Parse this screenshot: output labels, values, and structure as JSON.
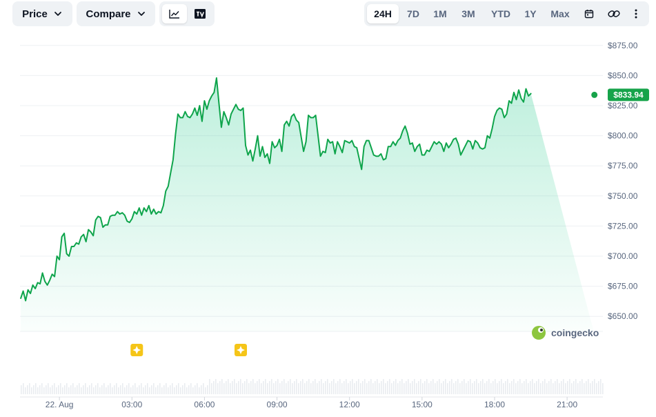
{
  "toolbar": {
    "price_label": "Price",
    "compare_label": "Compare",
    "ranges": [
      "24H",
      "7D",
      "1M",
      "3M",
      "YTD",
      "1Y",
      "Max"
    ],
    "active_range": "24H",
    "icons": {
      "line_chart": "line-chart-icon",
      "tradingview": "tradingview-icon",
      "calendar": "calendar-icon",
      "link": "link-icon",
      "more": "more-vertical-icon"
    }
  },
  "watermark": {
    "text": "coingecko"
  },
  "colors": {
    "line": "#16c784",
    "line_dark": "#0ea44b",
    "badge": "#16a34a",
    "event_marker": "#f5c518"
  },
  "chart_data": {
    "type": "area",
    "title": "",
    "xlabel": "",
    "ylabel": "",
    "ylim": [
      637.5,
      887.5
    ],
    "y_ticks": [
      "$875.00",
      "$850.00",
      "$825.00",
      "$800.00",
      "$775.00",
      "$750.00",
      "$725.00",
      "$700.00",
      "$675.00",
      "$650.00"
    ],
    "y_tick_values": [
      875,
      850,
      825,
      800,
      775,
      750,
      725,
      700,
      675,
      650
    ],
    "x_ticks": [
      "22. Aug",
      "03:00",
      "06:00",
      "09:00",
      "12:00",
      "15:00",
      "18:00",
      "21:00"
    ],
    "x_tick_hours": [
      0,
      3,
      6,
      9,
      12,
      15,
      18,
      21
    ],
    "xlim_hours": [
      -1.63,
      22.48
    ],
    "current_price_label": "$833.94",
    "current_price": 833.94,
    "event_markers_hours": [
      3.2,
      7.5
    ],
    "series": [
      {
        "x_hours": [
          -1.6,
          -1.5,
          -1.4,
          -1.3,
          -1.2,
          -1.1,
          -1.0,
          -0.9,
          -0.8,
          -0.7,
          -0.6,
          -0.5,
          -0.4,
          -0.3,
          -0.2,
          -0.1,
          0.0,
          0.1,
          0.2,
          0.3,
          0.4,
          0.5,
          0.6,
          0.7,
          0.8,
          0.9,
          1.0,
          1.1,
          1.2,
          1.3,
          1.4,
          1.5,
          1.6,
          1.7,
          1.8,
          1.9,
          2.0,
          2.1,
          2.2,
          2.3,
          2.4,
          2.5,
          2.6,
          2.7,
          2.8,
          2.9,
          3.0,
          3.1,
          3.2,
          3.3,
          3.4,
          3.5,
          3.6,
          3.7,
          3.8,
          3.9,
          4.0,
          4.1,
          4.2,
          4.3,
          4.4,
          4.5,
          4.6,
          4.7,
          4.8,
          4.9,
          5.0,
          5.1,
          5.2,
          5.3,
          5.4,
          5.5,
          5.6,
          5.7,
          5.8,
          5.9,
          6.0,
          6.1,
          6.2,
          6.3,
          6.4,
          6.5,
          6.6,
          6.7,
          6.8,
          6.9,
          7.0,
          7.1,
          7.2,
          7.3,
          7.4,
          7.5,
          7.6,
          7.7,
          7.8,
          7.9,
          8.0,
          8.1,
          8.2,
          8.3,
          8.4,
          8.5,
          8.6,
          8.7,
          8.8,
          8.9,
          9.0,
          9.1,
          9.2,
          9.3,
          9.4,
          9.5,
          9.6,
          9.7,
          9.8,
          9.9,
          10.0,
          10.1,
          10.2,
          10.3,
          10.4,
          10.5,
          10.6,
          10.7,
          10.8,
          10.9,
          11.0,
          11.1,
          11.2,
          11.3,
          11.4,
          11.5,
          11.6,
          11.7,
          11.8,
          11.9,
          12.0,
          12.1,
          12.2,
          12.3,
          12.4,
          12.5,
          12.6,
          12.7,
          12.8,
          12.9,
          13.0,
          13.1,
          13.2,
          13.3,
          13.4,
          13.5,
          13.6,
          13.7,
          13.8,
          13.9,
          14.0,
          14.1,
          14.2,
          14.3,
          14.4,
          14.5,
          14.6,
          14.7,
          14.8,
          14.9,
          15.0,
          15.1,
          15.2,
          15.3,
          15.4,
          15.5,
          15.6,
          15.7,
          15.8,
          15.9,
          16.0,
          16.1,
          16.2,
          16.3,
          16.4,
          16.5,
          16.6,
          16.7,
          16.8,
          16.9,
          17.0,
          17.1,
          17.2,
          17.3,
          17.4,
          17.5,
          17.6,
          17.7,
          17.8,
          17.9,
          18.0,
          18.1,
          18.2,
          18.3,
          18.4,
          18.5,
          18.6,
          18.7,
          18.8,
          18.9,
          19.0,
          19.1,
          19.2,
          19.3,
          19.4,
          19.5,
          19.6,
          19.7,
          19.8,
          19.9,
          20.0,
          20.1,
          20.2,
          20.3,
          20.4,
          20.5,
          20.6,
          20.7,
          20.8,
          20.9,
          21.0,
          21.1,
          21.2,
          21.3,
          21.4,
          21.5,
          21.6,
          21.7,
          21.8,
          21.9,
          22.0,
          22.1
        ],
        "values": [
          665,
          671,
          663,
          672,
          669,
          676,
          673,
          678,
          677,
          686,
          679,
          676,
          680,
          685,
          683,
          700,
          697,
          716,
          719,
          702,
          700,
          708,
          708,
          711,
          710,
          716,
          718,
          712,
          722,
          720,
          717,
          730,
          733,
          732,
          724,
          726,
          726,
          733,
          734,
          734,
          737,
          735,
          736,
          734,
          729,
          728,
          731,
          737,
          735,
          740,
          734,
          740,
          737,
          742,
          735,
          739,
          735,
          737,
          736,
          742,
          754,
          758,
          769,
          780,
          801,
          818,
          815,
          815,
          820,
          816,
          815,
          818,
          823,
          817,
          825,
          812,
          829,
          822,
          829,
          833,
          836,
          848,
          827,
          807,
          820,
          815,
          809,
          818,
          822,
          826,
          822,
          821,
          823,
          792,
          784,
          788,
          779,
          789,
          800,
          783,
          791,
          782,
          785,
          777,
          795,
          790,
          792,
          797,
          787,
          809,
          812,
          808,
          816,
          818,
          813,
          811,
          799,
          787,
          795,
          817,
          815,
          815,
          817,
          800,
          783,
          787,
          786,
          797,
          794,
          795,
          785,
          795,
          791,
          786,
          796,
          795,
          794,
          796,
          791,
          790,
          781,
          772,
          791,
          796,
          796,
          790,
          784,
          783,
          783,
          785,
          780,
          781,
          791,
          791,
          795,
          792,
          796,
          798,
          804,
          808,
          802,
          793,
          794,
          787,
          791,
          793,
          784,
          784,
          788,
          787,
          791,
          795,
          793,
          795,
          793,
          787,
          794,
          790,
          793,
          797,
          798,
          793,
          784,
          788,
          792,
          796,
          795,
          789,
          796,
          794,
          790,
          789,
          790,
          800,
          798,
          806,
          816,
          821,
          823,
          822,
          815,
          818,
          829,
          827,
          836,
          830,
          838,
          831,
          828,
          839,
          833,
          835
        ]
      }
    ]
  }
}
